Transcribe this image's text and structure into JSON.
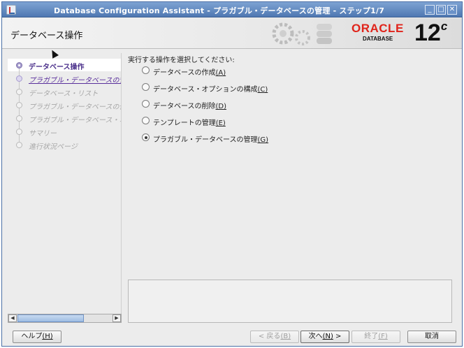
{
  "window": {
    "title": "Database Configuration Assistant - プラガブル・データベースの管理 - ステップ1/7",
    "controls": {
      "minimize": "_",
      "maximize": "□",
      "close": "✕"
    }
  },
  "header": {
    "title": "データベース操作",
    "logo_word": "ORACLE",
    "logo_sub": "DATABASE",
    "version": "12",
    "version_suffix": "c"
  },
  "nav": {
    "steps": [
      {
        "label": "データベース操作",
        "state": "current"
      },
      {
        "label": "プラガブル・データベースの管理",
        "state": "link"
      },
      {
        "label": "データベース・リスト",
        "state": "disabled"
      },
      {
        "label": "プラガブル・データベースの作成",
        "state": "disabled"
      },
      {
        "label": "プラガブル・データベース・オプション",
        "state": "disabled"
      },
      {
        "label": "サマリー",
        "state": "disabled"
      },
      {
        "label": "進行状況ページ",
        "state": "disabled"
      }
    ]
  },
  "main": {
    "prompt": "実行する操作を選択してください:",
    "options": [
      {
        "text": "データベースの作成",
        "mnemonic": "(A)",
        "selected": false
      },
      {
        "text": "データベース・オプションの構成",
        "mnemonic": "(C)",
        "selected": false
      },
      {
        "text": "データベースの削除",
        "mnemonic": "(D)",
        "selected": false
      },
      {
        "text": "テンプレートの管理",
        "mnemonic": "(E)",
        "selected": false
      },
      {
        "text": "プラガブル・データベースの管理",
        "mnemonic": "(G)",
        "selected": true
      }
    ]
  },
  "buttons": {
    "help": {
      "text": "ヘルプ",
      "mnemonic": "(H)"
    },
    "back": {
      "text": "< 戻る",
      "mnemonic": "(B)"
    },
    "next": {
      "text": "次へ",
      "mnemonic": "(N)",
      "suffix": " >"
    },
    "finish": {
      "text": "終了",
      "mnemonic": "(F)"
    },
    "cancel": {
      "text": "取消"
    }
  }
}
